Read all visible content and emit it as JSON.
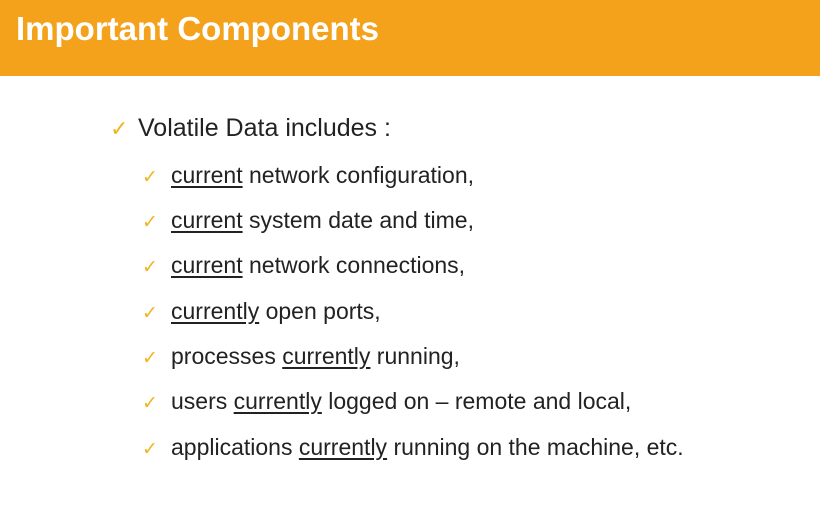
{
  "slide": {
    "title": "Important Components"
  },
  "main": {
    "heading": "Volatile Data includes :",
    "items": [
      {
        "pre": "",
        "u": "current",
        "post": " network configuration,"
      },
      {
        "pre": "",
        "u": "current",
        "post": " system date and time,"
      },
      {
        "pre": "",
        "u": "current",
        "post": " network connections,"
      },
      {
        "pre": "",
        "u": "currently",
        "post": " open ports,"
      },
      {
        "pre": "processes ",
        "u": "currently",
        "post": " running,"
      },
      {
        "pre": "users ",
        "u": "currently",
        "post": " logged on – remote and local,"
      },
      {
        "pre": "applications ",
        "u": "currently",
        "post": " running on the machine, etc."
      }
    ]
  },
  "icons": {
    "bullet": "check-icon",
    "glyph": "✓"
  },
  "colors": {
    "header": "#f4a11c",
    "check": "#f1b41c",
    "text": "#222222"
  }
}
